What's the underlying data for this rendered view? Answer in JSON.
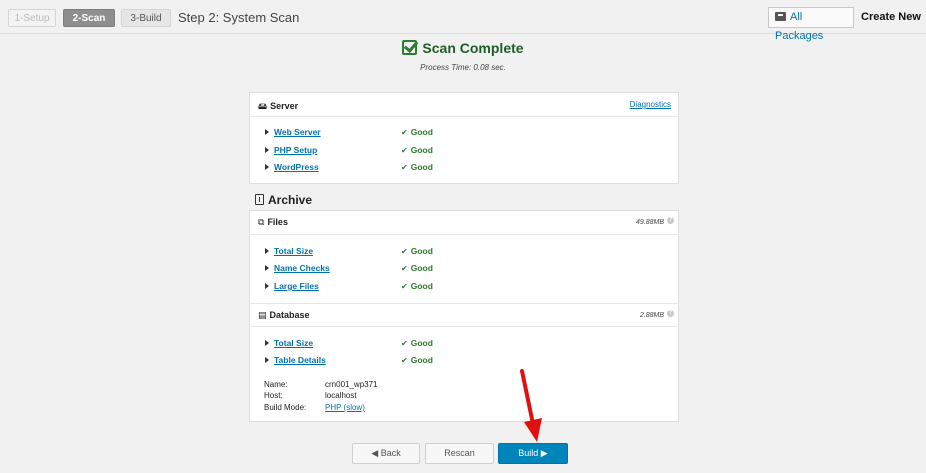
{
  "header": {
    "steps": [
      {
        "label": "1-Setup"
      },
      {
        "label": "2-Scan"
      },
      {
        "label": "3-Build"
      }
    ],
    "title": "Step 2: System Scan",
    "all_packages": "All Packages",
    "create_new": "Create New"
  },
  "scan": {
    "title": "Scan Complete",
    "process_time": "Process Time: 0.08 sec."
  },
  "server": {
    "title": "Server",
    "diagnostics": "Diagnostics",
    "items": [
      {
        "label": "Web Server",
        "status": "Good"
      },
      {
        "label": "PHP Setup",
        "status": "Good"
      },
      {
        "label": "WordPress",
        "status": "Good"
      }
    ]
  },
  "archive": {
    "title": "Archive",
    "files": {
      "title": "Files",
      "size": "49.88MB",
      "items": [
        {
          "label": "Total Size",
          "status": "Good"
        },
        {
          "label": "Name Checks",
          "status": "Good"
        },
        {
          "label": "Large Files",
          "status": "Good"
        }
      ]
    },
    "database": {
      "title": "Database",
      "size": "2.88MB",
      "items": [
        {
          "label": "Total Size",
          "status": "Good"
        },
        {
          "label": "Table Details",
          "status": "Good"
        }
      ],
      "meta": {
        "name_label": "Name:",
        "name": "crn001_wp371",
        "host_label": "Host:",
        "host": "localhost",
        "mode_label": "Build Mode:",
        "mode": "PHP (slow)"
      }
    }
  },
  "buttons": {
    "back": "◀ Back",
    "rescan": "Rescan",
    "build": "Build ▶"
  },
  "colors": {
    "accent": "#0073aa",
    "build_button": "#0085ba",
    "good": "#2d7a2d",
    "annotation_arrow": "#e01010"
  }
}
